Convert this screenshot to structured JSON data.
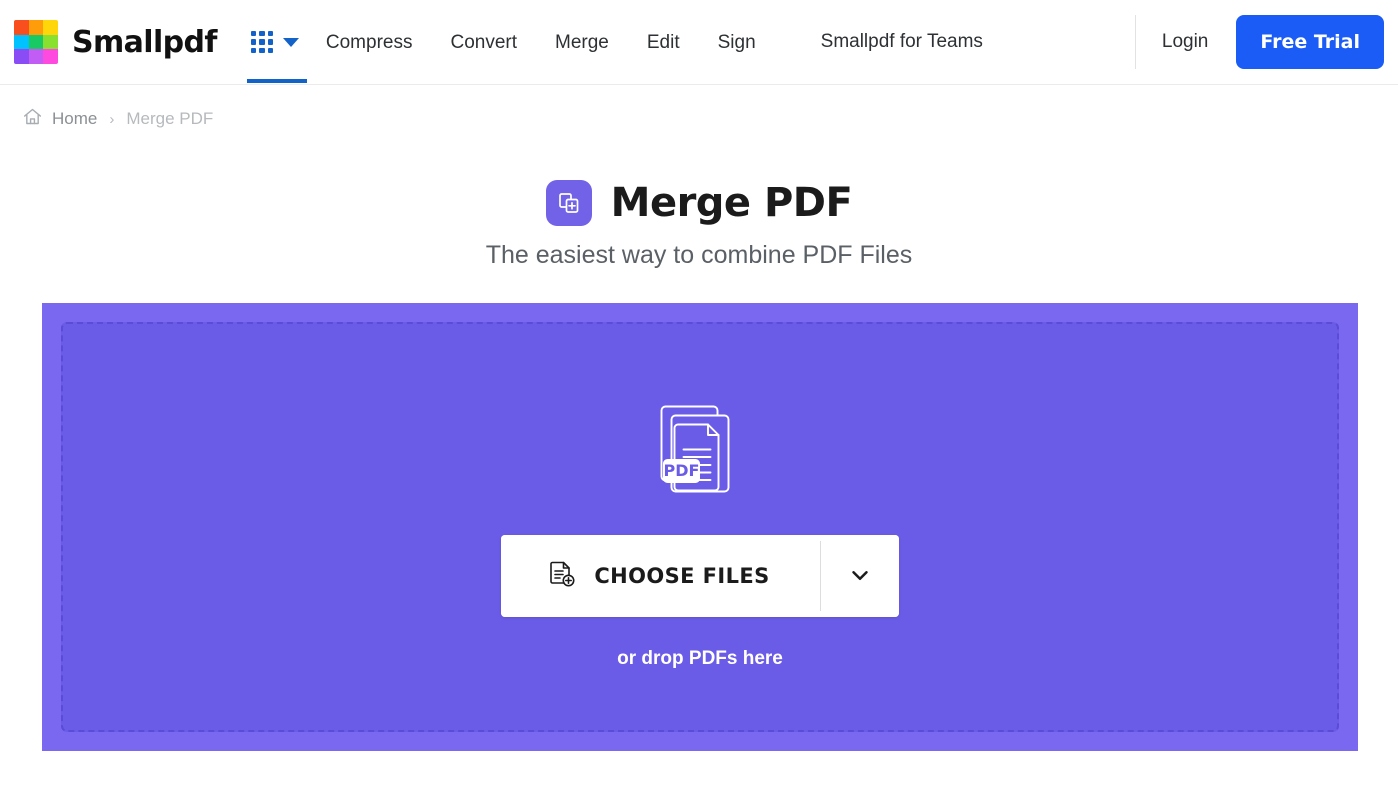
{
  "header": {
    "brand_name": "Smallpdf",
    "logo_colors": [
      "#f94e1e",
      "#ff9c0a",
      "#ffd60a",
      "#00c2ff",
      "#18c964",
      "#8ae02e",
      "#8a4cf5",
      "#c15cf5",
      "#ff4ae0"
    ],
    "apps_menu_icon": "apps-grid-icon",
    "apps_menu_caret": "chevron-down-icon",
    "nav_items": [
      {
        "label": "Compress"
      },
      {
        "label": "Convert"
      },
      {
        "label": "Merge"
      },
      {
        "label": "Edit"
      },
      {
        "label": "Sign"
      }
    ],
    "teams_label": "Smallpdf for Teams",
    "login_label": "Login",
    "free_trial_label": "Free Trial",
    "accent_blue": "#1a5cf5",
    "menu_blue": "#1262c7"
  },
  "breadcrumb": {
    "home_icon": "home-icon",
    "home_label": "Home",
    "separator": "›",
    "current_label": "Merge PDF"
  },
  "page": {
    "icon": "merge-pdf-icon",
    "icon_color": "#7162e8",
    "title": "Merge PDF",
    "subtitle": "The easiest way to combine PDF Files"
  },
  "dropzone": {
    "illustration": "stacked-pdf-documents-icon",
    "illustration_badge": "PDF",
    "choose_files_icon": "document-add-icon",
    "choose_files_label": "CHOOSE FILES",
    "dropdown_caret": "chevron-down-icon",
    "drop_hint": "or drop PDFs here",
    "outer_color": "#7a68f0",
    "inner_color": "#6b5ce7"
  }
}
